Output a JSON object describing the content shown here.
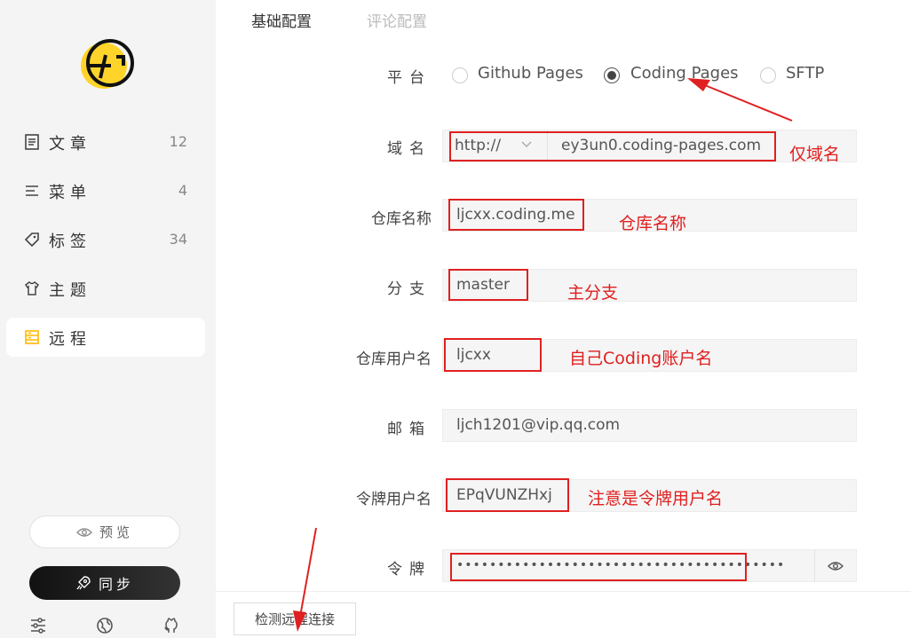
{
  "sidebar": {
    "items": [
      {
        "label": "文章",
        "count": "12",
        "icon": "document-icon"
      },
      {
        "label": "菜单",
        "count": "4",
        "icon": "menu-icon"
      },
      {
        "label": "标签",
        "count": "34",
        "icon": "tag-icon"
      },
      {
        "label": "主题",
        "count": "",
        "icon": "shirt-icon"
      },
      {
        "label": "远程",
        "count": "",
        "icon": "server-icon"
      }
    ],
    "preview_label": "预览",
    "sync_label": "同步",
    "bottom_icons": [
      "settings-sliders-icon",
      "globe-icon",
      "github-icon"
    ],
    "logo_color": "#FFD42A"
  },
  "tabs": [
    {
      "label": "基础配置",
      "active": true
    },
    {
      "label": "评论配置",
      "active": false
    }
  ],
  "form": {
    "platform_label": "平台",
    "platform_options": [
      "Github Pages",
      "Coding Pages",
      "SFTP"
    ],
    "platform_selected": "Coding Pages",
    "domain_label": "域名",
    "domain_protocol": "http://",
    "domain_value": "ey3un0.coding-pages.com",
    "repo_label": "仓库名称",
    "repo_value": "ljcxx.coding.me",
    "branch_label": "分支",
    "branch_value": "master",
    "user_label": "仓库用户名",
    "user_value": "ljcxx",
    "email_label": "邮箱",
    "email_value": "ljch1201@vip.qq.com",
    "token_user_label": "令牌用户名",
    "token_user_value": "EPqVUNZHxj",
    "token_label": "令牌",
    "token_value": "••••••••••••••••••••••••••••••••••••••••"
  },
  "check_button_label": "检测远程连接",
  "annotations": {
    "domain_note": "仅域名",
    "repo_note": "仓库名称",
    "branch_note": "主分支",
    "user_note": "自己Coding账户名",
    "token_user_note": "注意是令牌用户名"
  },
  "colors": {
    "annotation_red": "#e02020",
    "logo_yellow": "#FFD42A",
    "sync_dark": "#111111"
  }
}
